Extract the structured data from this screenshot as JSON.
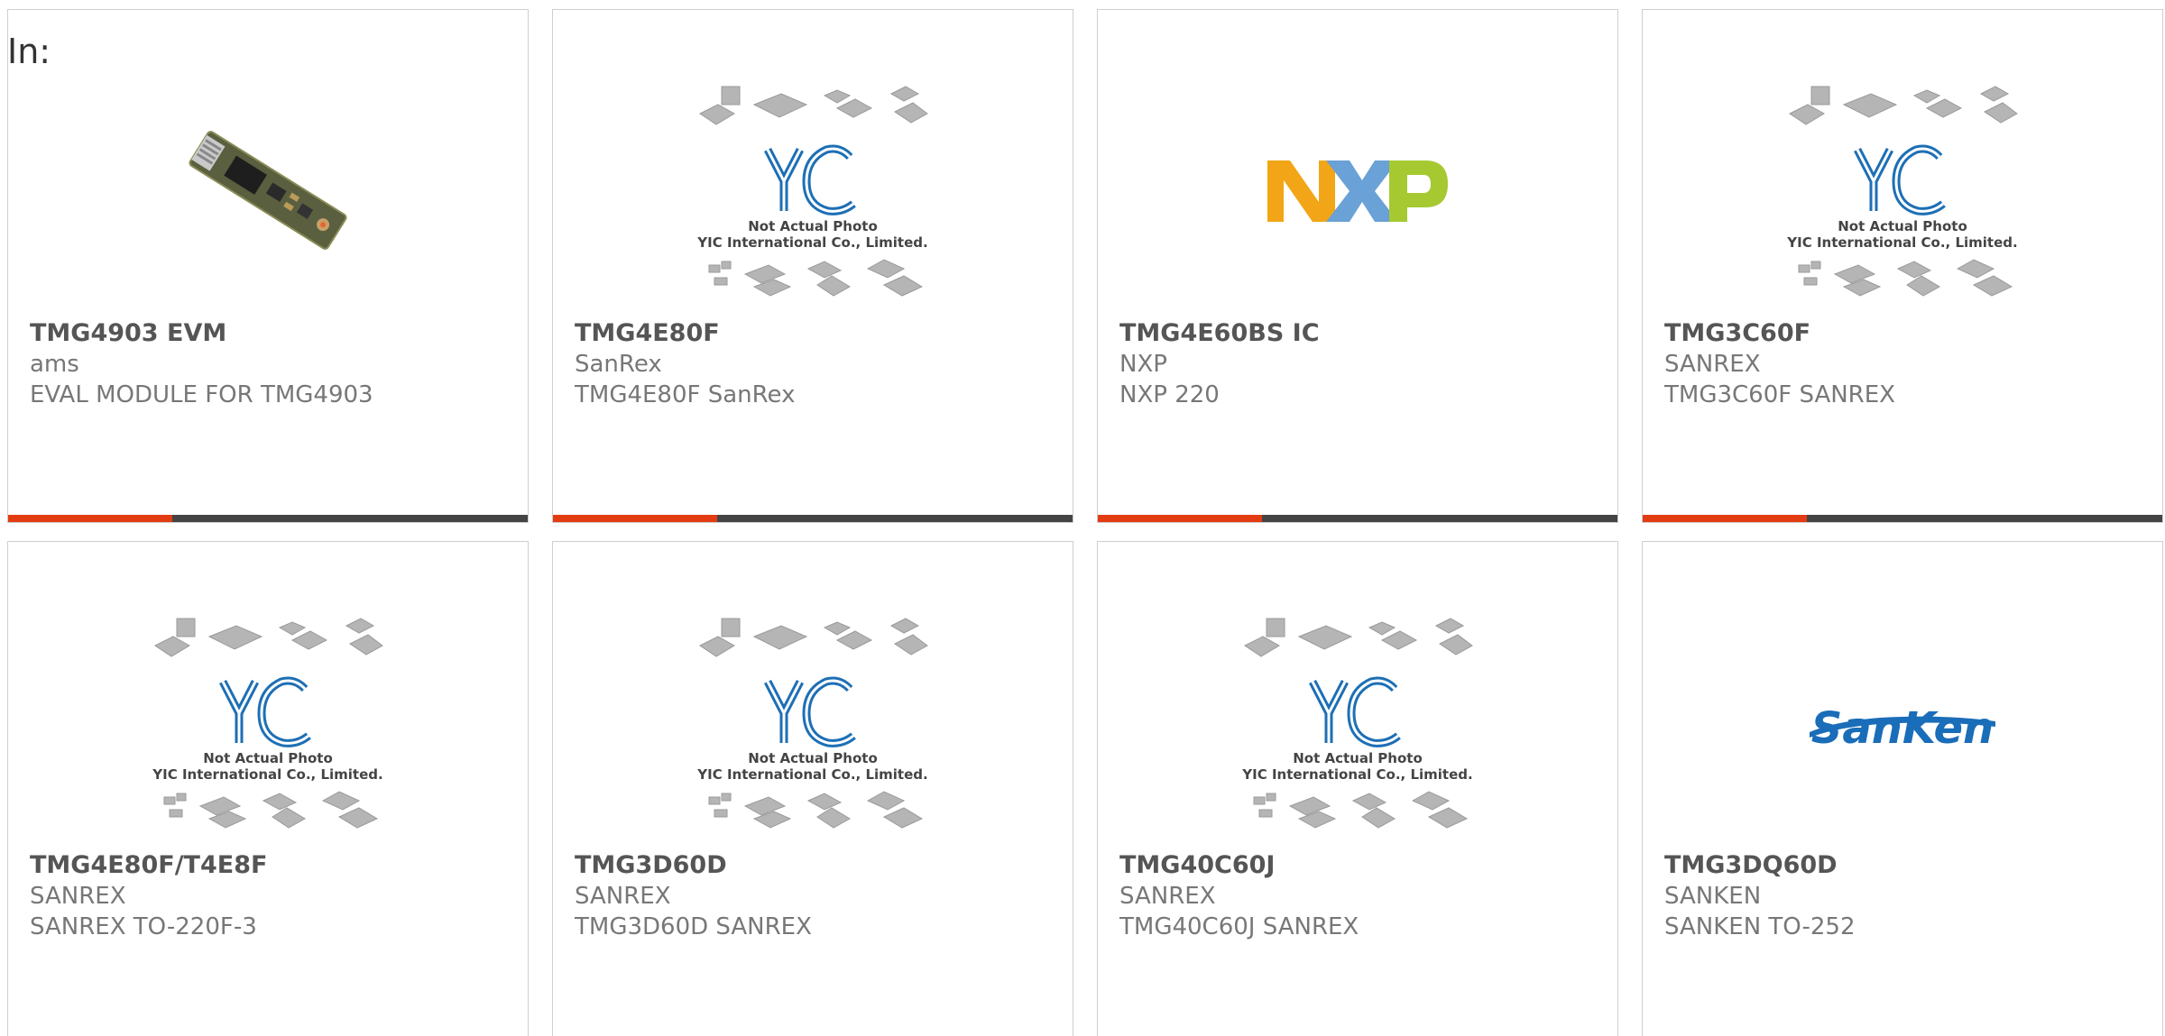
{
  "filter": {
    "label": "In:"
  },
  "placeholder": {
    "line1": "Not Actual Photo",
    "line2": "YIC International Co., Limited."
  },
  "logos": {
    "nxp": [
      "N",
      "X",
      "P"
    ],
    "sanken": "SanKen"
  },
  "colors": {
    "accent_bar": "#e33b12",
    "bar": "#444444",
    "card_border": "#cfcfcf",
    "nxp_n": "#f2a516",
    "nxp_x": "#6aa1d6",
    "nxp_p": "#a6c931",
    "sanken_blue": "#1a6db8",
    "yic_blue": "#1d6fb5"
  },
  "products": [
    {
      "part": "TMG4903 EVM",
      "manufacturer": "ams",
      "description": "EVAL MODULE FOR TMG4903",
      "image": "pcb-module-photo"
    },
    {
      "part": "TMG4E80F",
      "manufacturer": "SanRex",
      "description": "TMG4E80F SanRex",
      "image": "not-actual-photo"
    },
    {
      "part": "TMG4E60BS IC",
      "manufacturer": "NXP",
      "description": "NXP 220",
      "image": "nxp-logo"
    },
    {
      "part": "TMG3C60F",
      "manufacturer": "SANREX",
      "description": "TMG3C60F SANREX",
      "image": "not-actual-photo"
    },
    {
      "part": "TMG4E80F/T4E8F",
      "manufacturer": "SANREX",
      "description": "SANREX TO-220F-3",
      "image": "not-actual-photo"
    },
    {
      "part": "TMG3D60D",
      "manufacturer": "SANREX",
      "description": "TMG3D60D SANREX",
      "image": "not-actual-photo"
    },
    {
      "part": "TMG40C60J",
      "manufacturer": "SANREX",
      "description": "TMG40C60J SANREX",
      "image": "not-actual-photo"
    },
    {
      "part": "TMG3DQ60D",
      "manufacturer": "SANKEN",
      "description": "SANKEN TO-252",
      "image": "sanken-logo"
    }
  ]
}
